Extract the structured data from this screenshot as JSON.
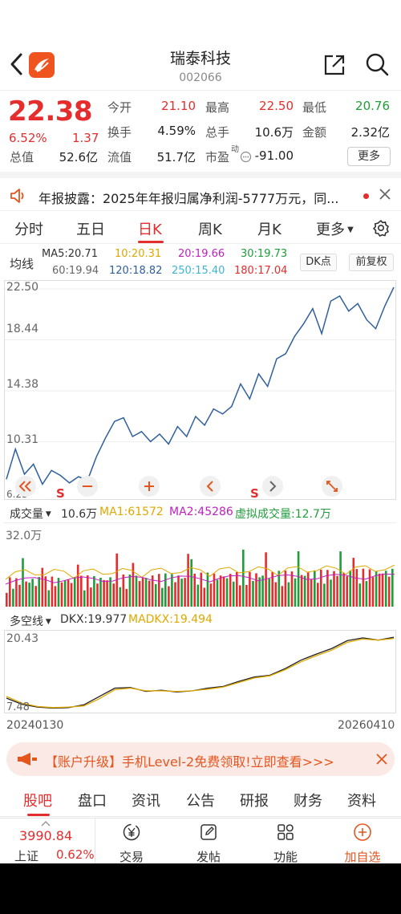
{
  "header": {
    "title": "瑞泰科技",
    "code": "002066"
  },
  "quote": {
    "price": "22.38",
    "pct": "6.52%",
    "change": "1.37",
    "fields": {
      "open_label": "今开",
      "open": "21.10",
      "high_label": "最高",
      "high": "22.50",
      "low_label": "最低",
      "low": "20.76",
      "turnover_label": "换手",
      "turnover": "4.59%",
      "volume_label": "总手",
      "volume": "10.6万",
      "amount_label": "金额",
      "amount": "2.32亿",
      "mktcap_label": "总值",
      "mktcap": "52.6亿",
      "float_label": "流值",
      "float": "51.7亿",
      "pe_label": "市盈",
      "pe_sup": "动",
      "pe": "-91.00"
    },
    "more_label": "更多"
  },
  "notice": {
    "text": "年报披露：2025年年报归属净利润-5777万元，同..."
  },
  "tabs": [
    "分时",
    "五日",
    "日K",
    "周K",
    "月K",
    "更多"
  ],
  "active_tab": "日K",
  "ma": {
    "label": "均线",
    "ma5": "MA5:20.71",
    "ma10": "10:20.31",
    "ma20": "20:19.66",
    "ma30": "30:19.73",
    "ma60": "60:19.94",
    "ma120": "120:18.82",
    "ma250": "250:15.40",
    "ma180": "180:17.04",
    "dk_label": "DK点",
    "adj_label": "前复权"
  },
  "colors": {
    "up": "#e52d2d",
    "down": "#1f9d3a",
    "line": "#2f5f9e",
    "ma_yellow": "#e0a800",
    "ma_magenta": "#c020c0",
    "ma_cyan": "#3cb4d8"
  },
  "chart_data": [
    {
      "type": "line",
      "title": "",
      "x": [
        "20240130",
        "20260410"
      ],
      "y_ticks": [
        "22.50",
        "18.44",
        "14.38",
        "10.31",
        "6.25"
      ],
      "ylim": [
        6.25,
        22.5
      ],
      "series": [
        {
          "values": [
            7.2,
            9.6,
            7.6,
            8.4,
            6.8,
            7.9,
            7.5,
            6.9,
            7.4,
            7.1,
            9.0,
            10.5,
            11.8,
            12.1,
            10.6,
            11.0,
            10.2,
            10.8,
            10.0,
            11.4,
            10.6,
            12.2,
            11.5,
            12.8,
            12.4,
            13.0,
            14.8,
            13.6,
            15.6,
            14.6,
            16.8,
            17.2,
            18.6,
            19.6,
            20.8,
            18.8,
            21.4,
            21.8,
            20.6,
            21.2,
            19.9,
            19.2,
            21.0,
            22.5
          ]
        }
      ]
    },
    {
      "type": "bar",
      "label": "成交量",
      "values": {
        "vol": "10.6万",
        "ma1": "MA1:61572",
        "ma2": "MA2:45286",
        "virtual": "虚拟成交量:12.7万"
      },
      "ymax": "32.0万"
    },
    {
      "type": "line",
      "label": "多空线",
      "dkx": "DKX:19.977",
      "madkx": "MADKX:19.494",
      "y_ticks": [
        "20.43",
        "7.48"
      ],
      "ylim": [
        7.48,
        20.43
      ],
      "series": [
        {
          "name": "DKX",
          "values": [
            9.5,
            8.4,
            7.9,
            7.7,
            7.8,
            8.3,
            9.8,
            11.3,
            11.4,
            10.7,
            10.9,
            10.6,
            10.8,
            11.3,
            11.6,
            12.5,
            13.3,
            13.6,
            14.8,
            16.3,
            17.4,
            18.4,
            19.8,
            20.3,
            19.9,
            20.4
          ]
        },
        {
          "name": "MADKX",
          "values": [
            9.8,
            8.6,
            8.0,
            7.8,
            7.9,
            8.1,
            9.4,
            11.0,
            11.3,
            10.8,
            10.8,
            10.7,
            10.8,
            11.1,
            11.5,
            12.3,
            13.1,
            13.5,
            14.6,
            16.0,
            17.1,
            18.1,
            19.5,
            20.1,
            19.9,
            20.2
          ]
        }
      ]
    }
  ],
  "dates": {
    "start": "20240130",
    "end": "20260410"
  },
  "promo": {
    "text": "【账户升级】手机Level-2免费领取!立即查看>>>"
  },
  "subtabs": [
    "股吧",
    "盘口",
    "资讯",
    "公告",
    "研报",
    "财务",
    "资料"
  ],
  "bottom": {
    "index_value": "3990.84",
    "index_name": "上证",
    "index_pct": "0.62%",
    "items": [
      "交易",
      "发帖",
      "功能",
      "加自选"
    ]
  }
}
